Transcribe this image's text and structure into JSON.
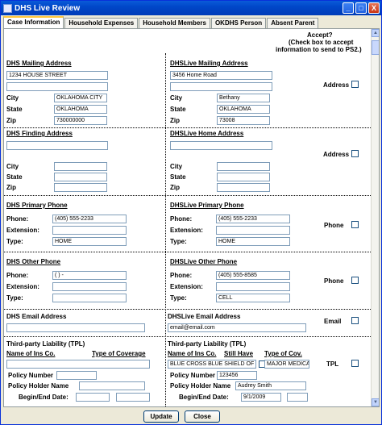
{
  "window": {
    "title": "DHS Live Review",
    "minimize": "_",
    "maximize": "□",
    "close": "X"
  },
  "tabs": [
    "Case Information",
    "Household Expenses",
    "Household Members",
    "OKDHS Person",
    "Absent Parent"
  ],
  "accept": {
    "line1": "Accept?",
    "line2": "(Check box to accept",
    "line3": "information to send to PS2.)"
  },
  "mailing": {
    "dhs_header": "DHS Mailing Address",
    "live_header": "DHSLive Mailing Address",
    "dhs_line1": "1234 HOUSE STREET",
    "dhs_line2": "",
    "dhs_city": "OKLAHOMA CITY",
    "dhs_state": "OKLAHOMA",
    "dhs_zip": "730000000",
    "live_line1": "3456 Home Road",
    "live_line2": "",
    "live_city": "Bethany",
    "live_state": "OKLAHOMA",
    "live_zip": "73008",
    "accept_label": "Address"
  },
  "finding": {
    "dhs_header": "DHS Finding Address",
    "live_header": "DHSLive Home Address",
    "accept_label": "Address"
  },
  "labels": {
    "city": "City",
    "state": "State",
    "zip": "Zip",
    "phone": "Phone:",
    "extension": "Extension:",
    "type": "Type:"
  },
  "primary_phone": {
    "dhs_header": "DHS Primary Phone",
    "live_header": "DHSLive Primary Phone",
    "dhs_phone": "(405) 555-2233",
    "dhs_type": "HOME",
    "live_phone": "(405) 555-2233",
    "live_type": "HOME",
    "accept_label": "Phone"
  },
  "other_phone": {
    "dhs_header": "DHS Other Phone",
    "live_header": "DHSLive Other Phone",
    "dhs_phone": "(   )   -",
    "dhs_type": "",
    "live_phone": "(405) 555-8585",
    "live_type": "CELL",
    "accept_label": "Phone"
  },
  "email": {
    "dhs_header": "DHS Email Address",
    "live_header": "DHSLive Email Address",
    "dhs_value": "",
    "live_value": "email@email.com",
    "accept_label": "Email"
  },
  "tpl": {
    "dhs_header": "Third-party Liability (TPL)",
    "live_header": "Third-party Liability (TPL)",
    "name_ins": "Name of Ins Co.",
    "type_cov": "Type of Coverage",
    "still_have": "Still Have",
    "type_cov_short": "Type of Cov.",
    "policy_number": "Policy Number",
    "policy_holder": "Policy Holder Name",
    "begin_end": "Begin/End Date:",
    "live_ins_name": "BLUE CROSS BLUE SHIELD OF",
    "live_type_cov": "MAJOR MEDICAL",
    "live_policy_number": "123456",
    "live_holder": "Audrey Smith",
    "live_begin": "9/1/2009",
    "accept_label": "TPL"
  },
  "buttons": {
    "update": "Update",
    "close": "Close"
  }
}
